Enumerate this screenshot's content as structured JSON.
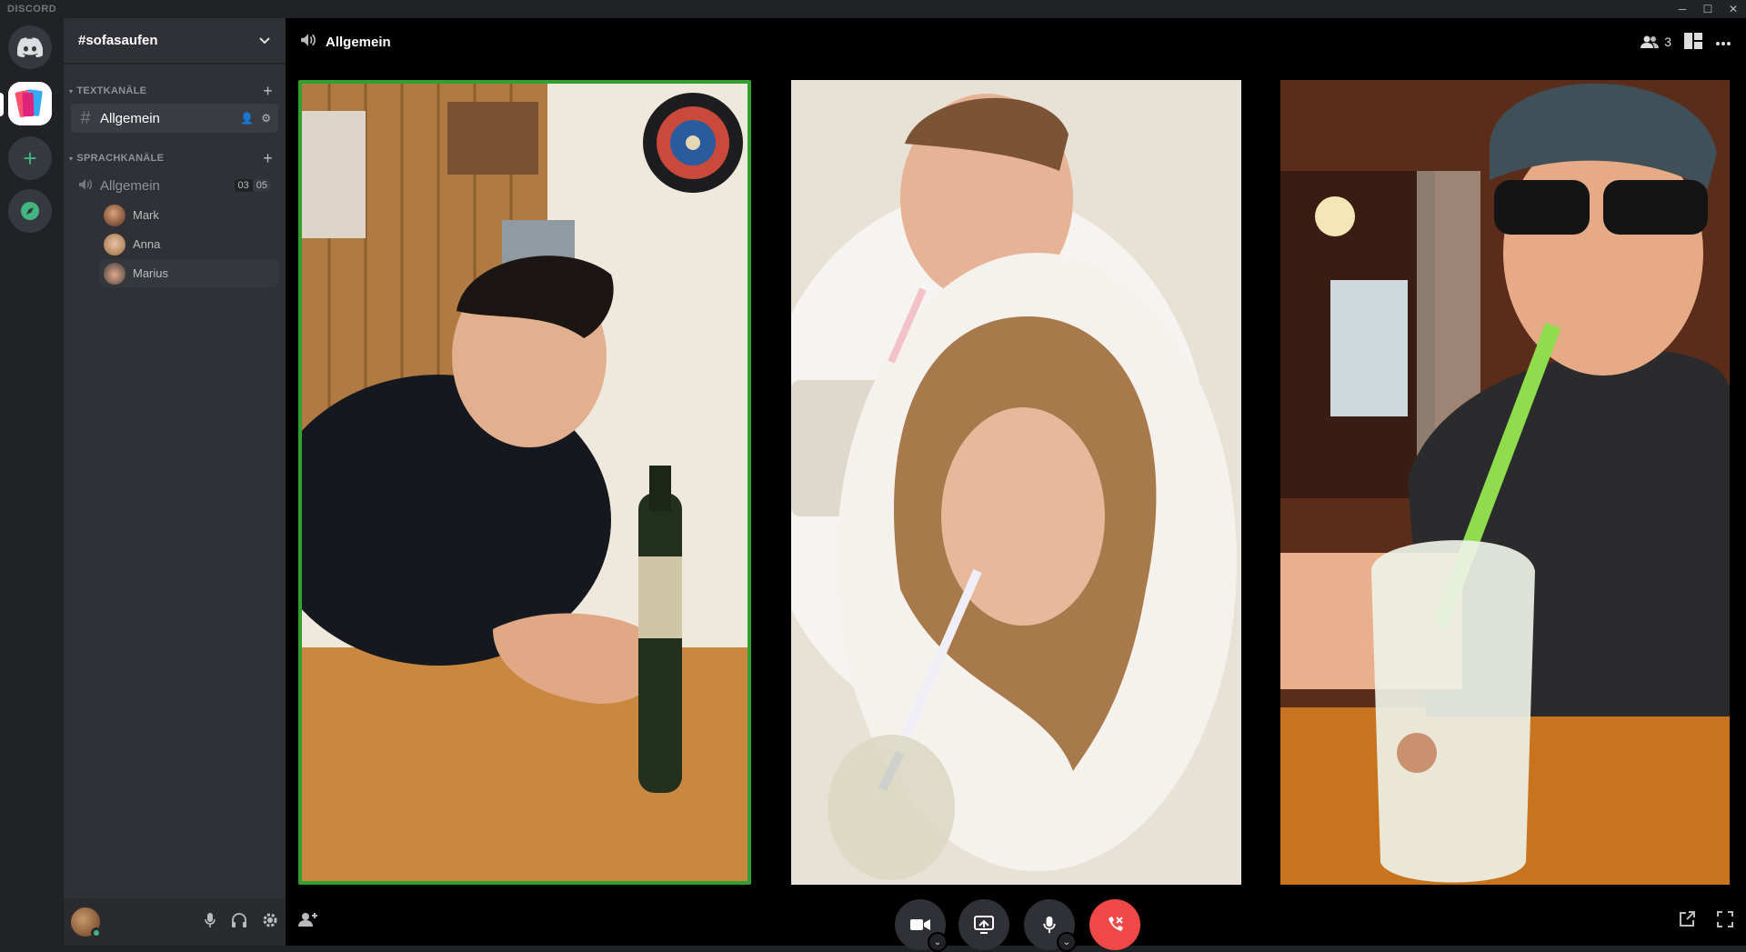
{
  "window": {
    "brand": "DISCORD",
    "controls": [
      "─",
      "☐",
      "✕"
    ]
  },
  "server": {
    "name": "#sofasaufen"
  },
  "categories": {
    "text": "TEXTKANÄLE",
    "voice": "SPRACHKANÄLE"
  },
  "text_channels": [
    {
      "name": "Allgemein",
      "active": true
    }
  ],
  "voice_channels": [
    {
      "name": "Allgemein",
      "badge_left": "03",
      "badge_right": "05"
    }
  ],
  "voice_users": [
    {
      "name": "Mark"
    },
    {
      "name": "Anna"
    },
    {
      "name": "Marius"
    }
  ],
  "call": {
    "channel_title": "Allgemein",
    "participant_count": "3"
  },
  "colors": {
    "speaking_border": "#32a030",
    "hangup": "#f04747",
    "online": "#43b581"
  },
  "icons": {
    "home": "discord-logo-icon",
    "add_server": "plus-icon",
    "explore": "compass-icon",
    "speaker": "speaker-icon",
    "people": "people-icon",
    "grid": "layout-grid-icon",
    "more": "more-horizontal-icon",
    "camera": "video-camera-icon",
    "screen": "screen-share-icon",
    "mic": "microphone-icon",
    "hangup": "hangup-icon",
    "popout": "popout-icon",
    "fullscreen": "fullscreen-icon",
    "add_person": "add-person-icon"
  }
}
